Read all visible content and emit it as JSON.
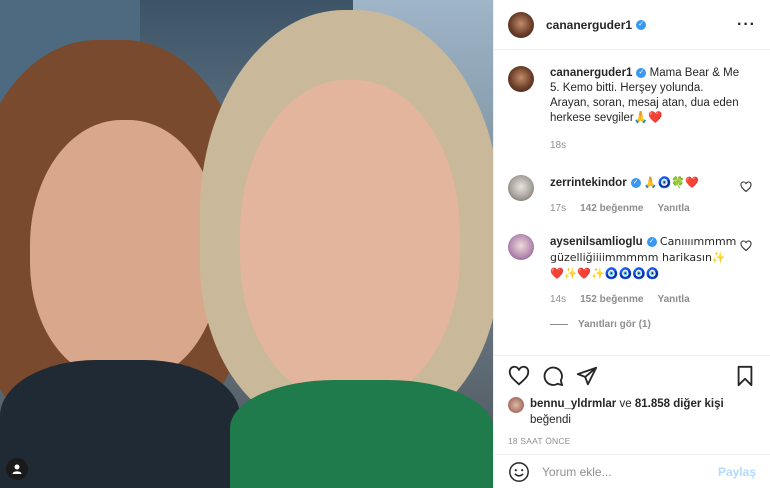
{
  "post": {
    "username": "cananerguder1",
    "caption_username": "cananerguder1",
    "caption": "Mama Bear & Me 5. Kemo bitti. Herşey yolunda. Arayan, soran, mesaj atan, dua eden herkese sevgiler🙏❤️",
    "caption_time": "18s"
  },
  "comments": [
    {
      "username": "zerrintekindor",
      "text": "🙏🧿🍀❤️",
      "time": "17s",
      "likes": "142 beğenme",
      "reply": "Yanıtla"
    },
    {
      "username": "aysenilsamlioglu",
      "text": "Canıııımmmm güzelliğiiiimmmmm harikasın✨ ❤️✨❤️✨🧿🧿🧿🧿",
      "time": "14s",
      "likes": "152 beğenme",
      "reply": "Yanıtla",
      "view_replies": "Yanıtları gör (1)"
    }
  ],
  "likes": {
    "user": "bennu_yldrmlar",
    "connector": "ve",
    "others": "81.858 diğer kişi",
    "suffix": "beğendi"
  },
  "timestamp": "18 SAAT ÖNCE",
  "composer": {
    "placeholder": "Yorum ekle...",
    "share_label": "Paylaş"
  },
  "colors": {
    "verified": "#3897f0",
    "heart": "#ed4956",
    "share_disabled": "#b3dbff"
  }
}
